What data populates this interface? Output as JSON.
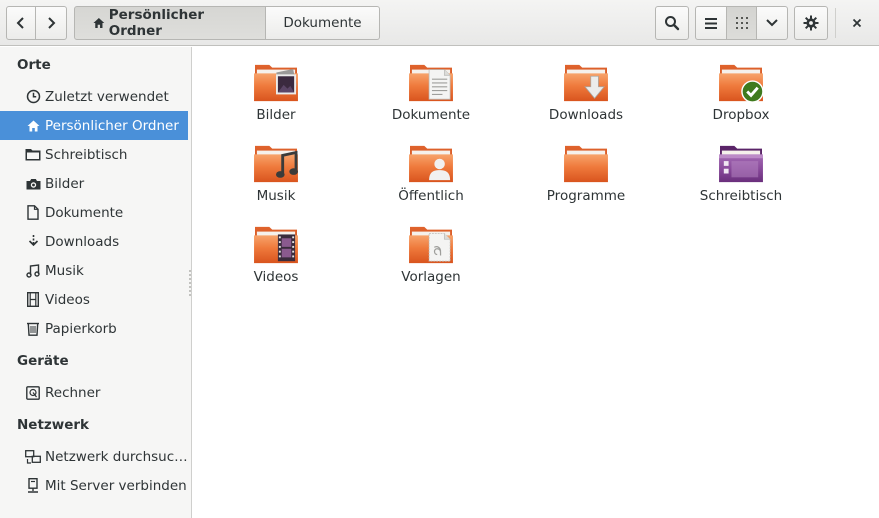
{
  "header": {
    "path": [
      {
        "label": "Persönlicher Ordner",
        "icon": "home-icon",
        "active": true
      },
      {
        "label": "Dokumente",
        "active": false
      }
    ],
    "close_label": "×"
  },
  "sidebar": {
    "sections": [
      {
        "heading": "Orte",
        "items": [
          {
            "label": "Zuletzt verwendet",
            "icon": "clock-icon"
          },
          {
            "label": "Persönlicher Ordner",
            "icon": "home-icon",
            "selected": true
          },
          {
            "label": "Schreibtisch",
            "icon": "folder-icon"
          },
          {
            "label": "Bilder",
            "icon": "camera-icon"
          },
          {
            "label": "Dokumente",
            "icon": "document-icon"
          },
          {
            "label": "Downloads",
            "icon": "download-icon"
          },
          {
            "label": "Musik",
            "icon": "music-icon"
          },
          {
            "label": "Videos",
            "icon": "film-icon"
          },
          {
            "label": "Papierkorb",
            "icon": "trash-icon"
          }
        ]
      },
      {
        "heading": "Geräte",
        "items": [
          {
            "label": "Rechner",
            "icon": "drive-icon"
          }
        ]
      },
      {
        "heading": "Netzwerk",
        "items": [
          {
            "label": "Netzwerk durchsuc…",
            "icon": "network-icon"
          },
          {
            "label": "Mit Server verbinden",
            "icon": "server-icon"
          }
        ]
      }
    ]
  },
  "files": [
    {
      "label": "Bilder",
      "icon": "pictures-folder-icon"
    },
    {
      "label": "Dokumente",
      "icon": "documents-folder-icon"
    },
    {
      "label": "Downloads",
      "icon": "downloads-folder-icon"
    },
    {
      "label": "Dropbox",
      "icon": "dropbox-folder-icon"
    },
    {
      "label": "Musik",
      "icon": "music-folder-icon"
    },
    {
      "label": "Öffentlich",
      "icon": "public-folder-icon"
    },
    {
      "label": "Programme",
      "icon": "folder-icon"
    },
    {
      "label": "Schreibtisch",
      "icon": "desktop-folder-icon"
    },
    {
      "label": "Videos",
      "icon": "videos-folder-icon"
    },
    {
      "label": "Vorlagen",
      "icon": "templates-folder-icon"
    }
  ],
  "colors": {
    "accent": "#4a90d9",
    "folder_orange": "#e8652b",
    "desktop_purple": "#7b3f8e"
  }
}
